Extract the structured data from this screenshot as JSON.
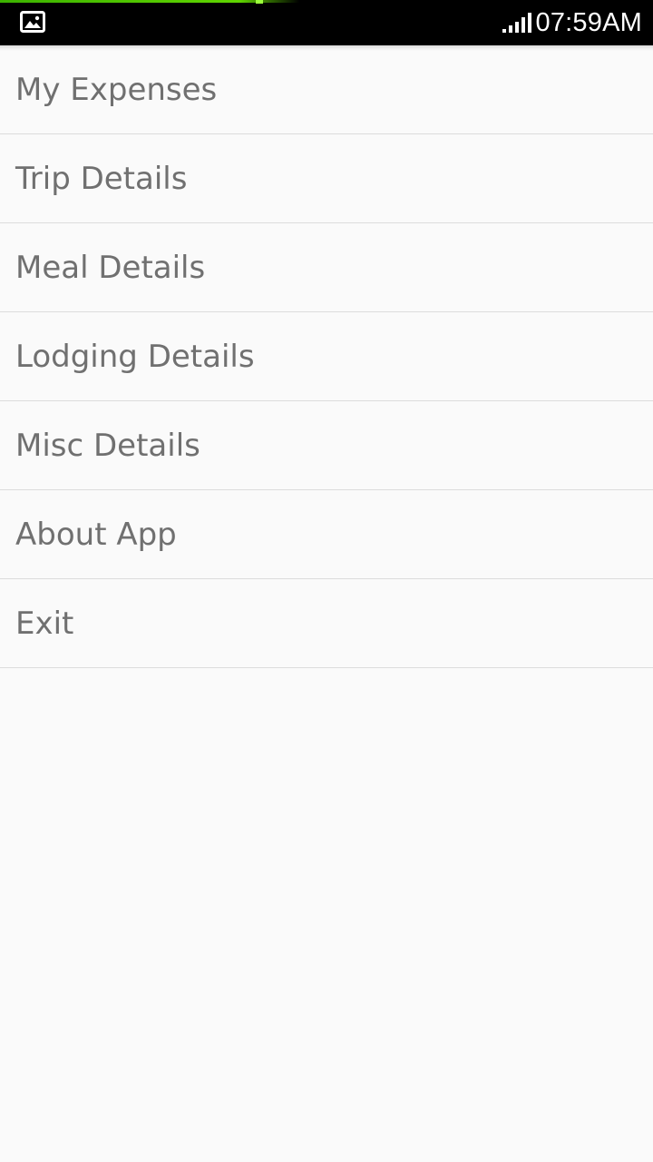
{
  "status_bar": {
    "time": "07:59AM",
    "notification_icon": "image-icon",
    "signal_icon": "signal-bars-icon",
    "progress_color": "#5fd400"
  },
  "menu": {
    "items": [
      {
        "label": "My Expenses"
      },
      {
        "label": "Trip Details"
      },
      {
        "label": "Meal Details"
      },
      {
        "label": "Lodging Details"
      },
      {
        "label": "Misc Details"
      },
      {
        "label": "About App"
      },
      {
        "label": "Exit"
      }
    ]
  },
  "colors": {
    "background": "#fafafa",
    "text": "#707070",
    "divider": "#dcdcdc"
  }
}
